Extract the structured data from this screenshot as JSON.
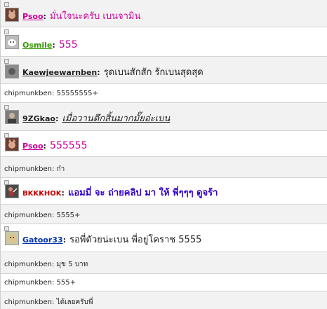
{
  "messages": [
    {
      "type": "user",
      "user": "Psoo",
      "sep": ":",
      "text": "มั่นใจนะครับ เบนจามิน",
      "user_color": "#cc0099",
      "text_color": "#cc0099",
      "avatar": "cat-avatar"
    },
    {
      "type": "user",
      "user": "Osmile",
      "sep": ":",
      "text": "555",
      "user_color": "#339900",
      "text_color": "#cc0099",
      "avatar": "white-creature-avatar"
    },
    {
      "type": "user",
      "user": "Kaewjeewarnben",
      "sep": ":",
      "text": "รุดเบนสักสัก รักเบนสุดสุด",
      "user_color": "#222222",
      "text_color": "#222222",
      "avatar": "small-dot"
    },
    {
      "type": "system",
      "text": "chipmunkben: 55555555+"
    },
    {
      "type": "user",
      "user": "9ZGkao",
      "sep": ":",
      "text": "เมื่อวานตึกสิ้นมากมั๊ยอ่ะเบน",
      "user_color": "#222222",
      "text_color": "#222222",
      "avatar": "person-avatar"
    },
    {
      "type": "user",
      "user": "Psoo",
      "sep": ":",
      "text": "555555",
      "user_color": "#cc0099",
      "text_color": "#cc0099",
      "avatar": "cat-avatar"
    },
    {
      "type": "system",
      "text": "chipmunkben: ก๋า"
    },
    {
      "type": "user",
      "user": "BKKKHOK",
      "sep": ":",
      "text": "แอมมี่ จะ ถ่ายคลิป มา ให้ พี่ๆๆๆ ดูจร้า",
      "user_color": "#cc0000",
      "text_color": "#3300cc",
      "avatar": "action-avatar"
    },
    {
      "type": "system",
      "text": "chipmunkben: 5555+"
    },
    {
      "type": "user",
      "user": "Gatoor33",
      "sep": ":",
      "text": "รอพี่ตัวยน่ะเบน  พี่อยู่โคราช 5555",
      "user_color": "#0033aa",
      "text_color": "#222222",
      "avatar": "face-avatar"
    },
    {
      "type": "system",
      "text": "chipmunkben: มุข 5 บาท"
    },
    {
      "type": "system",
      "text": "chipmunkben: 555+"
    },
    {
      "type": "system",
      "text": "chipmunkben: ได้เลยครับพี่"
    }
  ]
}
